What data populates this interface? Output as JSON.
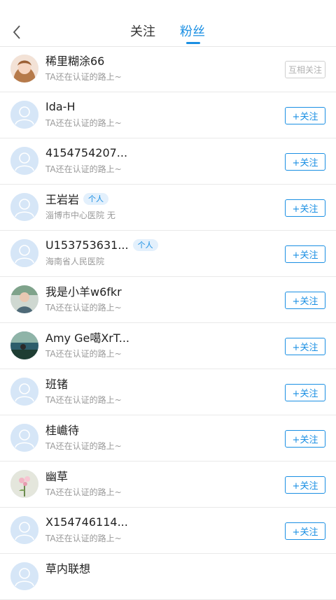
{
  "header": {
    "back_icon": "chevron-left-icon",
    "tabs": [
      {
        "label": "关注",
        "active": false
      },
      {
        "label": "粉丝",
        "active": true
      }
    ],
    "accent_color": "#1a8fe3"
  },
  "fans": [
    {
      "name": "稀里糊涂66",
      "tag": "",
      "sub": "TA还在认证的路上~",
      "button": "互相关注",
      "mutual": true,
      "avatar": "photo-girl"
    },
    {
      "name": "Ida-H",
      "tag": "",
      "sub": "TA还在认证的路上~",
      "button": "+关注",
      "mutual": false,
      "avatar": "default"
    },
    {
      "name": "4154754207...",
      "tag": "",
      "sub": "TA还在认证的路上~",
      "button": "+关注",
      "mutual": false,
      "avatar": "default"
    },
    {
      "name": "王岩岩",
      "tag": "个人",
      "sub": "淄博市中心医院 无",
      "button": "+关注",
      "mutual": false,
      "avatar": "default"
    },
    {
      "name": "U153753631...",
      "tag": "个人",
      "sub": "海南省人民医院",
      "button": "+关注",
      "mutual": false,
      "avatar": "default"
    },
    {
      "name": "我是小羊w6fkr",
      "tag": "",
      "sub": "TA还在认证的路上~",
      "button": "+关注",
      "mutual": false,
      "avatar": "photo-person"
    },
    {
      "name": "Amy Ge噶XrT...",
      "tag": "",
      "sub": "TA还在认证的路上~",
      "button": "+关注",
      "mutual": false,
      "avatar": "photo-beach"
    },
    {
      "name": "班锗",
      "tag": "",
      "sub": "TA还在认证的路上~",
      "button": "+关注",
      "mutual": false,
      "avatar": "default"
    },
    {
      "name": "桂巇待",
      "tag": "",
      "sub": "TA还在认证的路上~",
      "button": "+关注",
      "mutual": false,
      "avatar": "default"
    },
    {
      "name": "幽草",
      "tag": "",
      "sub": "TA还在认证的路上~",
      "button": "+关注",
      "mutual": false,
      "avatar": "photo-flower"
    },
    {
      "name": "X154746114...",
      "tag": "",
      "sub": "TA还在认证的路上~",
      "button": "+关注",
      "mutual": false,
      "avatar": "default"
    },
    {
      "name": "草内联想",
      "tag": "",
      "sub": "",
      "button": "",
      "mutual": false,
      "avatar": "default"
    }
  ]
}
